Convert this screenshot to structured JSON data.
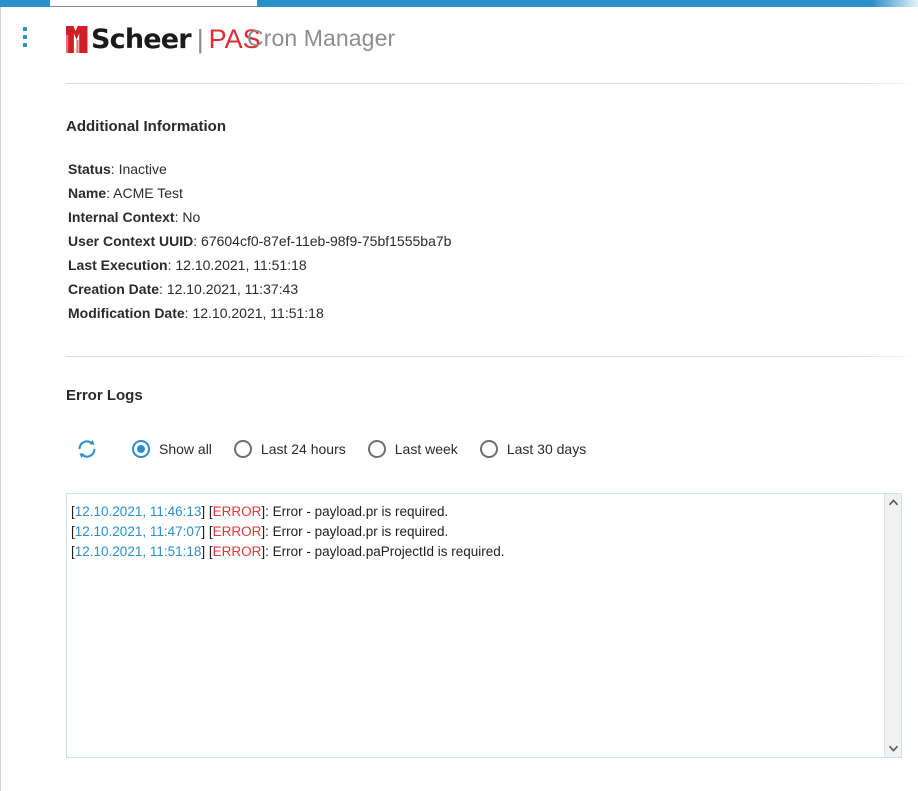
{
  "window": {
    "accent_blue": "#2b8fc9",
    "brand_red": "#e02b32"
  },
  "header": {
    "menu_icon": "kebab-menu-icon",
    "logo": {
      "mark": "scheer-logo-mark",
      "brand": "Scheer",
      "separator": "|",
      "product": "PAS"
    },
    "app_title": "Cron Manager"
  },
  "additional_info": {
    "title": "Additional Information",
    "rows": [
      {
        "label": "Status",
        "value": "Inactive"
      },
      {
        "label": "Name",
        "value": "ACME Test"
      },
      {
        "label": "Internal Context",
        "value": "No"
      },
      {
        "label": "User Context UUID",
        "value": "67604cf0-87ef-11eb-98f9-75bf1555ba7b"
      },
      {
        "label": "Last Execution",
        "value": "12.10.2021, 11:51:18"
      },
      {
        "label": "Creation Date",
        "value": "12.10.2021, 11:37:43"
      },
      {
        "label": "Modification Date",
        "value": "12.10.2021, 11:51:18"
      }
    ],
    "separator": ": "
  },
  "error_logs": {
    "title": "Error Logs",
    "refresh_icon": "refresh-icon",
    "filters": [
      {
        "label": "Show all",
        "checked": true
      },
      {
        "label": "Last 24 hours",
        "checked": false
      },
      {
        "label": "Last week",
        "checked": false
      },
      {
        "label": "Last 30 days",
        "checked": false
      }
    ],
    "entries": [
      {
        "open_bracket": "[",
        "timestamp": "12.10.2021, 11:46:13",
        "close_bracket": "] [",
        "severity": "ERROR",
        "message": "]: Error - payload.pr is required."
      },
      {
        "open_bracket": "[",
        "timestamp": "12.10.2021, 11:47:07",
        "close_bracket": "] [",
        "severity": "ERROR",
        "message": "]: Error - payload.pr is required."
      },
      {
        "open_bracket": "[",
        "timestamp": "12.10.2021, 11:51:18",
        "close_bracket": "] [",
        "severity": "ERROR",
        "message": "]: Error - payload.paProjectId is required."
      }
    ],
    "scrollbar": {
      "up_arrow": "chevron-up-icon",
      "down_arrow": "chevron-down-icon"
    }
  }
}
